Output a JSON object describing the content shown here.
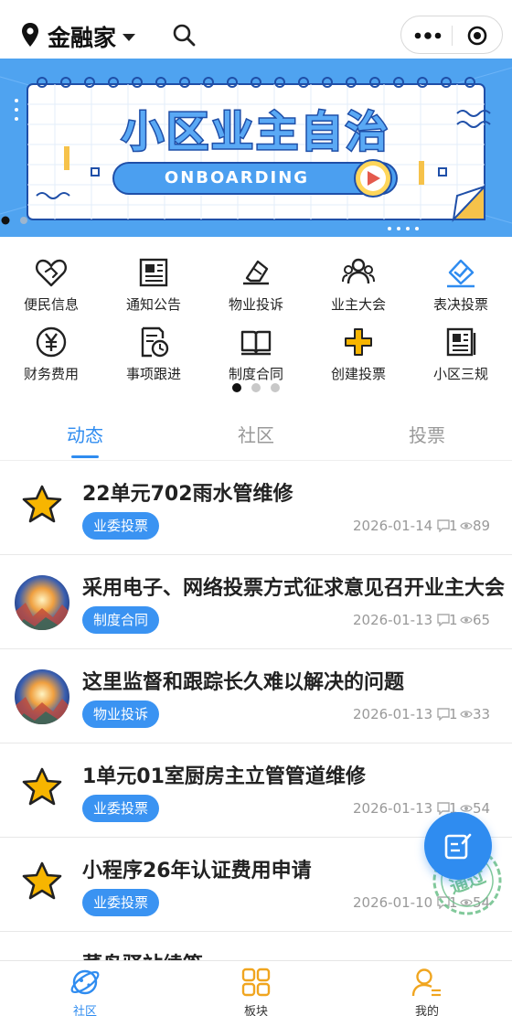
{
  "header": {
    "location": "金融家"
  },
  "banner": {
    "title": "小区业主自治",
    "subtitle": "ONBOARDING",
    "page_index": 1,
    "page_count": 2
  },
  "grid": {
    "items": [
      {
        "label": "便民信息",
        "icon": "heart-handshake-icon"
      },
      {
        "label": "通知公告",
        "icon": "newspaper-icon"
      },
      {
        "label": "物业投诉",
        "icon": "complaint-icon"
      },
      {
        "label": "业主大会",
        "icon": "people-group-icon"
      },
      {
        "label": "表决投票",
        "icon": "vote-check-icon"
      },
      {
        "label": "财务费用",
        "icon": "yuan-icon"
      },
      {
        "label": "事项跟进",
        "icon": "document-clock-icon"
      },
      {
        "label": "制度合同",
        "icon": "book-icon"
      },
      {
        "label": "创建投票",
        "icon": "plus-icon"
      },
      {
        "label": "小区三规",
        "icon": "regulations-icon"
      }
    ],
    "page_index": 1,
    "page_count": 3
  },
  "tabs": [
    {
      "label": "动态",
      "active": true
    },
    {
      "label": "社区",
      "active": false
    },
    {
      "label": "投票",
      "active": false
    }
  ],
  "feed": [
    {
      "title": "22单元702雨水管维修",
      "tag": "业委投票",
      "date": "2026-01-14",
      "comments": "1",
      "views": "89",
      "avatar": "star"
    },
    {
      "title": "采用电子、网络投票方式征求意见召开业主大会",
      "tag": "制度合同",
      "date": "2026-01-13",
      "comments": "1",
      "views": "65",
      "avatar": "painting"
    },
    {
      "title": "这里监督和跟踪长久难以解决的问题",
      "tag": "物业投诉",
      "date": "2026-01-13",
      "comments": "1",
      "views": "33",
      "avatar": "painting"
    },
    {
      "title": "1单元01室厨房主立管管道维修",
      "tag": "业委投票",
      "date": "2026-01-13",
      "comments": "1",
      "views": "54",
      "avatar": "star"
    },
    {
      "title": "小程序26年认证费用申请",
      "tag": "业委投票",
      "date": "2026-01-10",
      "comments": "1",
      "views": "54",
      "avatar": "star"
    },
    {
      "title": "菜鸟驿站续签",
      "tag": "",
      "date": "",
      "comments": "",
      "views": "",
      "avatar": "partial"
    }
  ],
  "stamp_text": "通过",
  "tabbar": [
    {
      "label": "社区",
      "icon": "planet-icon",
      "active": true
    },
    {
      "label": "板块",
      "icon": "grid-icon",
      "active": false
    },
    {
      "label": "我的",
      "icon": "user-icon",
      "active": false
    }
  ],
  "colors": {
    "accent": "#2f8cf0",
    "tag_bg": "#3a93f2",
    "banner_bg": "#4fa3f0",
    "star": "#f7b500",
    "tabbar_icon": "#f0a51f"
  }
}
